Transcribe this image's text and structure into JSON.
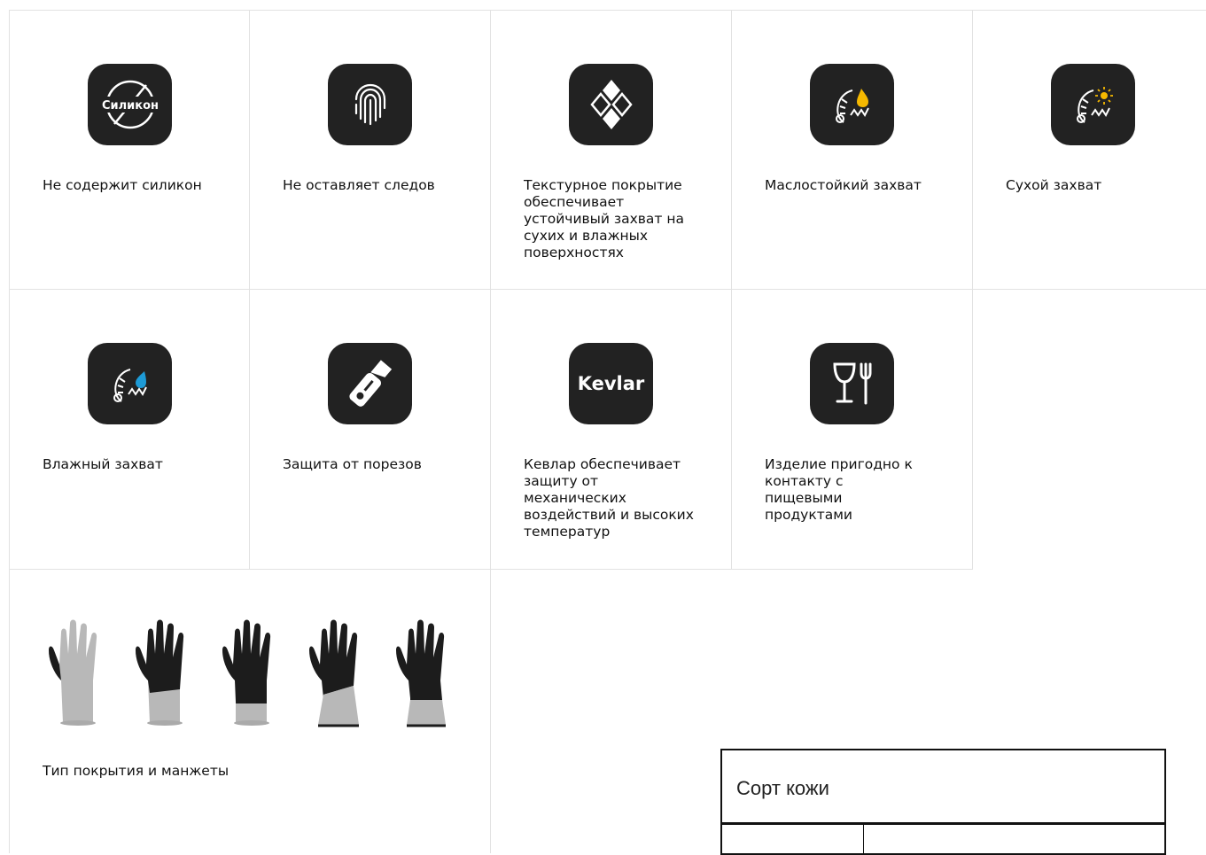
{
  "features_row1": [
    {
      "label": "Не содержит силикон",
      "icon": "no-silicone-icon",
      "icon_text": "Силикон"
    },
    {
      "label": "Не оставляет следов",
      "icon": "fingerprint-icon"
    },
    {
      "label": "Текстурное покрытие обеспечивает устойчивый захват на сухих и влажных поверхностях",
      "icon": "texture-diamonds-icon"
    },
    {
      "label": "Маслостойкий захват",
      "icon": "oil-grip-icon"
    },
    {
      "label": "Сухой захват",
      "icon": "dry-grip-icon"
    }
  ],
  "features_row2": [
    {
      "label": "Влажный захват",
      "icon": "wet-grip-icon"
    },
    {
      "label": "Защита от порезов",
      "icon": "cut-protection-icon"
    },
    {
      "label": "Кевлар обеспечивает защиту от механических воздействий и высоких температур",
      "icon": "kevlar-icon",
      "icon_text": "Kevlar"
    },
    {
      "label": "Изделие пригодно к контакту с пищевыми продуктами",
      "icon": "food-contact-icon"
    }
  ],
  "coating": {
    "label": "Тип покрытия и манжеты"
  },
  "spec_table": {
    "title": "Сорт кожи"
  },
  "colors": {
    "icon_bg": "#222222",
    "accent_yellow": "#f5b800",
    "accent_blue": "#1e9bd7",
    "border": "#e2e2e2"
  }
}
